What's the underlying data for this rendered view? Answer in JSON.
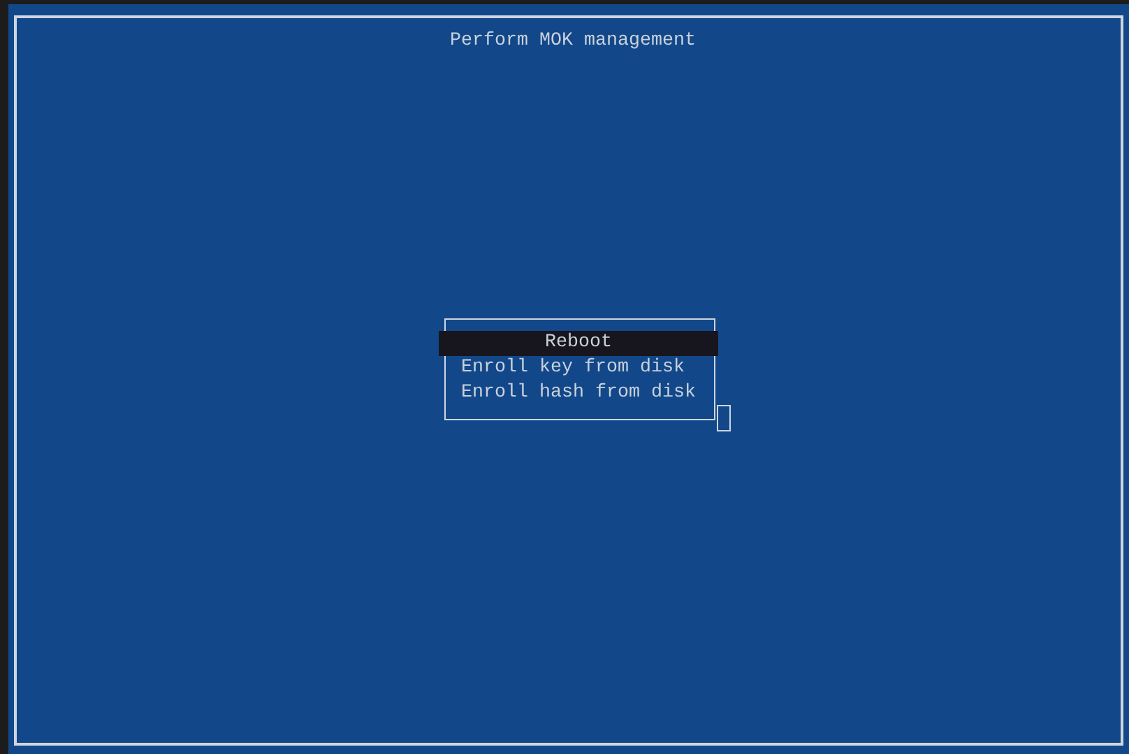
{
  "title": "Perform MOK management",
  "menu": {
    "items": [
      {
        "label": "Reboot",
        "selected": true
      },
      {
        "label": "Enroll key from disk",
        "selected": false
      },
      {
        "label": "Enroll hash from disk",
        "selected": false
      }
    ]
  }
}
